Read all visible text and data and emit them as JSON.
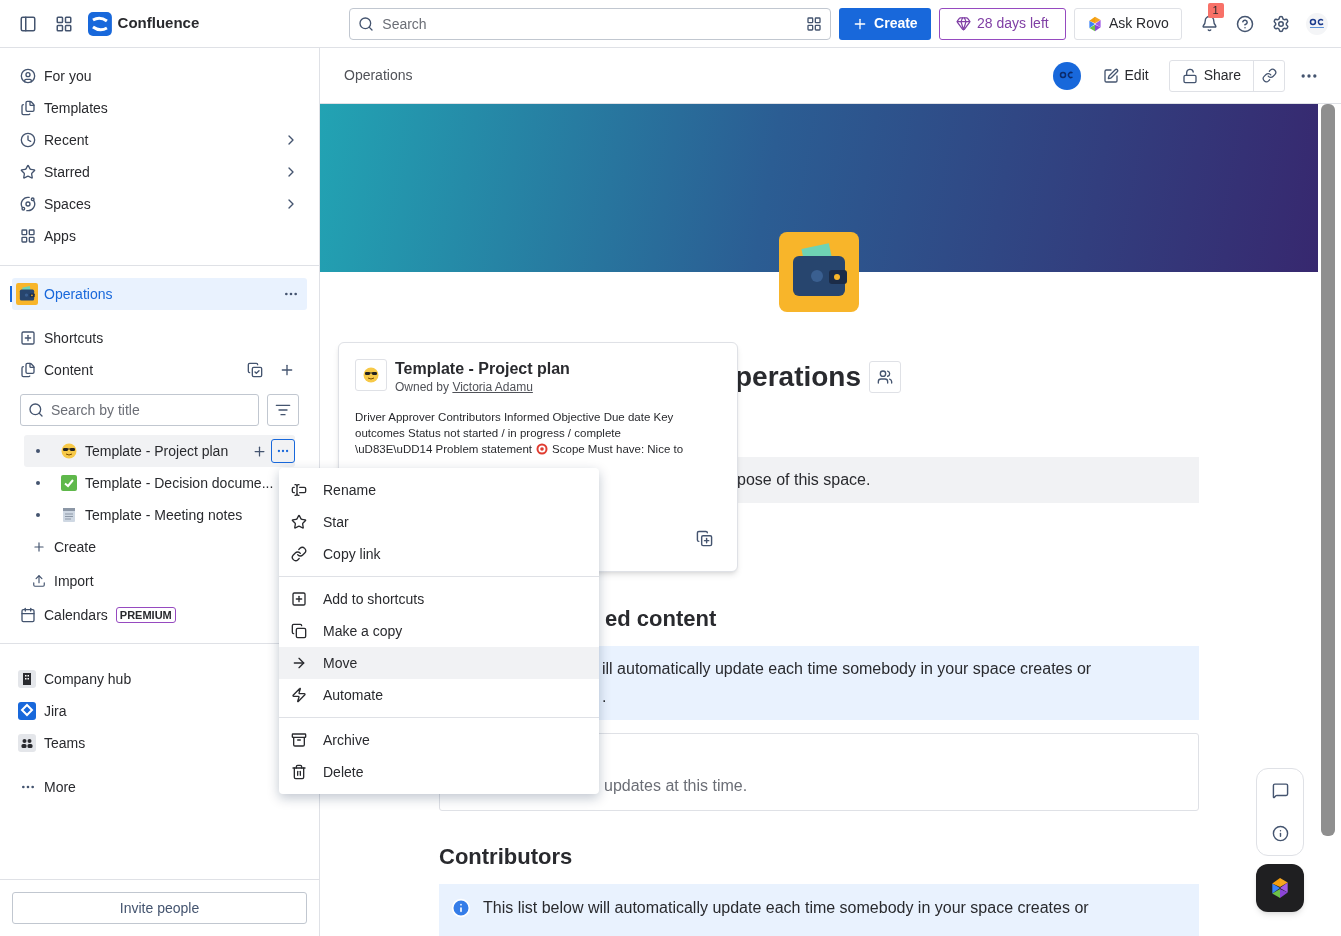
{
  "topbar": {
    "product": "Confluence",
    "search": {
      "placeholder": "Search"
    },
    "create": "Create",
    "trial": "28 days left",
    "rovo": "Ask Rovo",
    "notifications": "1"
  },
  "sidebar": {
    "nav": [
      {
        "kind": "you",
        "label": "For you",
        "expandable": false
      },
      {
        "kind": "templates",
        "label": "Templates",
        "expandable": false
      },
      {
        "kind": "recent",
        "label": "Recent",
        "expandable": true
      },
      {
        "kind": "starred",
        "label": "Starred",
        "expandable": true
      },
      {
        "kind": "spaces",
        "label": "Spaces",
        "expandable": true
      },
      {
        "kind": "apps",
        "label": "Apps",
        "expandable": false
      }
    ],
    "space": {
      "name": "Operations",
      "selected": true
    },
    "shortcuts": "Shortcuts",
    "content": "Content",
    "search": {
      "placeholder": "Search by title"
    },
    "tree": [
      {
        "kind": "sunglasses",
        "label": "Template - Project plan",
        "selected": true
      },
      {
        "kind": "check",
        "label": "Template - Decision docume...",
        "selected": false
      },
      {
        "kind": "notes",
        "label": "Template - Meeting notes",
        "selected": false
      }
    ],
    "create": "Create",
    "import": "Import",
    "calendars": "Calendars",
    "premium": "PREMIUM",
    "apps": [
      {
        "kind": "hub",
        "label": "Company hub"
      },
      {
        "kind": "jira",
        "label": "Jira"
      },
      {
        "kind": "teams",
        "label": "Teams"
      }
    ],
    "more": "More",
    "invite": "Invite people"
  },
  "header": {
    "breadcrumb": "Operations",
    "edit": "Edit",
    "share": "Share"
  },
  "page": {
    "title": "perations",
    "purpose": "pose of this space.",
    "section1": "ed content",
    "info1": [
      "ill automatically update each time somebody in your space creates or",
      "."
    ],
    "empty": "updates at this time.",
    "section2": "Contributors",
    "info2": [
      "This list below will automatically update each time somebody in your space creates or"
    ]
  },
  "card": {
    "title": "Template - Project plan",
    "owner_prefix": "Owned by",
    "owner": "Victoria Adamu",
    "excerpt_lines": [
      "Driver Approver Contributors Informed Objective Due date Key",
      "outcomes Status not started / in progress / complete"
    ],
    "excerpt_before": "\\uD83E\\uDD14 Problem statement",
    "excerpt_after": "Scope Must have: Nice to"
  },
  "menu": [
    [
      {
        "kind": "rename",
        "label": "Rename",
        "hovered": false
      },
      {
        "kind": "star",
        "label": "Star",
        "hovered": false
      },
      {
        "kind": "link",
        "label": "Copy link",
        "hovered": false
      }
    ],
    [
      {
        "kind": "shortcut",
        "label": "Add to shortcuts",
        "hovered": false
      },
      {
        "kind": "copy",
        "label": "Make a copy",
        "hovered": false
      },
      {
        "kind": "move",
        "label": "Move",
        "hovered": true
      },
      {
        "kind": "automate",
        "label": "Automate",
        "hovered": false
      }
    ],
    [
      {
        "kind": "archive",
        "label": "Archive",
        "hovered": false
      },
      {
        "kind": "delete",
        "label": "Delete",
        "hovered": false
      }
    ]
  ]
}
